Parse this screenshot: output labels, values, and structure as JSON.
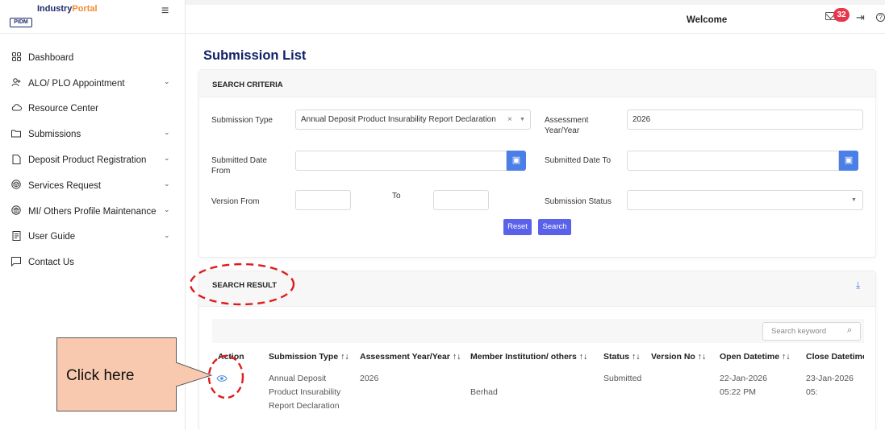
{
  "app": {
    "logo_mark": "PIDM",
    "logo_part1": "Industry",
    "logo_part2": "Portal"
  },
  "header": {
    "welcome": "Welcome",
    "notification_count": "32"
  },
  "sidebar": {
    "items": [
      {
        "label": "Dashboard",
        "icon": "grid-icon"
      },
      {
        "label": "ALO/ PLO Appointment",
        "icon": "user-add-icon",
        "expandable": true
      },
      {
        "label": "Resource Center",
        "icon": "cloud-icon"
      },
      {
        "label": "Submissions",
        "icon": "folder-icon",
        "expandable": true
      },
      {
        "label": "Deposit Product Registration",
        "icon": "document-icon",
        "expandable": true
      },
      {
        "label": "Services Request",
        "icon": "box-icon",
        "expandable": true
      },
      {
        "label": "MI/ Others Profile Maintenance",
        "icon": "bank-icon",
        "expandable": true
      },
      {
        "label": "User Guide",
        "icon": "book-icon",
        "expandable": true
      },
      {
        "label": "Contact Us",
        "icon": "message-icon"
      }
    ]
  },
  "page": {
    "title": "Submission List"
  },
  "search_criteria": {
    "title": "SEARCH CRITERIA",
    "submission_type_label": "Submission Type",
    "submission_type_value": "Annual Deposit Product Insurability Report Declaration",
    "assessment_year_label": "Assessment Year/Year",
    "assessment_year_value": "2026",
    "submitted_from_label": "Submitted Date From",
    "submitted_to_label": "Submitted Date To",
    "version_from_label": "Version From",
    "version_to_label": "To",
    "status_label": "Submission Status",
    "reset_label": "Reset",
    "search_label": "Search"
  },
  "search_result": {
    "title": "SEARCH RESULT",
    "keyword_placeholder": "Search keyword",
    "columns": [
      "Action",
      "Submission Type",
      "Assessment Year/Year",
      "Member Institution/ others",
      "Status",
      "Version No",
      "Open Datetime",
      "Close Datetime"
    ],
    "rows": [
      {
        "submission_type": "Annual Deposit Product Insurability Report Declaration",
        "assessment_year": "2026",
        "member_institution": "Berhad",
        "status": "Submitted",
        "version_no": "",
        "open_datetime": "22-Jan-2026 05:22 PM",
        "close_datetime": "23-Jan-2026 05:"
      }
    ]
  },
  "annotation": {
    "callout_text": "Click here",
    "highlight_color": "#e01b1b"
  }
}
